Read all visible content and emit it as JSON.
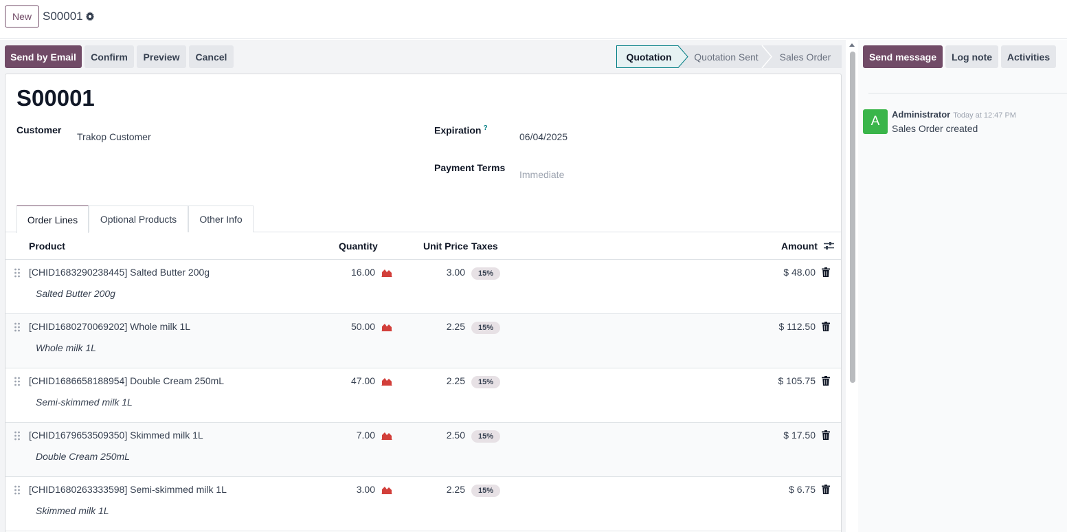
{
  "header": {
    "new_label": "New",
    "breadcrumb": "S00001"
  },
  "actions": {
    "send_email": "Send by Email",
    "confirm": "Confirm",
    "preview": "Preview",
    "cancel": "Cancel"
  },
  "status": {
    "steps": [
      "Quotation",
      "Quotation Sent",
      "Sales Order"
    ],
    "active": "Quotation"
  },
  "form": {
    "title": "S00001",
    "customer_label": "Customer",
    "customer_value": "Trakop Customer",
    "expiration_label": "Expiration",
    "expiration_help": "?",
    "expiration_value": "06/04/2025",
    "payment_terms_label": "Payment Terms",
    "payment_terms_value": "Immediate"
  },
  "tabs": [
    "Order Lines",
    "Optional Products",
    "Other Info"
  ],
  "table": {
    "headers": {
      "product": "Product",
      "quantity": "Quantity",
      "unit_price": "Unit Price",
      "taxes": "Taxes",
      "amount": "Amount"
    },
    "rows": [
      {
        "product": "[CHID1683290238445] Salted Butter 200g",
        "description": "Salted Butter 200g",
        "quantity": "16.00",
        "unit_price": "3.00",
        "tax": "15%",
        "amount": "$ 48.00"
      },
      {
        "product": "[CHID1680270069202] Whole milk 1L",
        "description": "Whole milk 1L",
        "quantity": "50.00",
        "unit_price": "2.25",
        "tax": "15%",
        "amount": "$ 112.50"
      },
      {
        "product": "[CHID1686658188954] Double Cream 250mL",
        "description": "Semi-skimmed milk 1L",
        "quantity": "47.00",
        "unit_price": "2.25",
        "tax": "15%",
        "amount": "$ 105.75"
      },
      {
        "product": "[CHID1679653509350] Skimmed milk 1L",
        "description": "Double Cream 250mL",
        "quantity": "7.00",
        "unit_price": "2.50",
        "tax": "15%",
        "amount": "$ 17.50"
      },
      {
        "product": "[CHID1680263333598] Semi-skimmed milk 1L",
        "description": "Skimmed milk 1L",
        "quantity": "3.00",
        "unit_price": "2.25",
        "tax": "15%",
        "amount": "$ 6.75"
      }
    ]
  },
  "chatter": {
    "send_message": "Send message",
    "log_note": "Log note",
    "activities": "Activities",
    "messages": [
      {
        "avatar": "A",
        "author": "Administrator",
        "time": "Today at 12:47 PM",
        "body": "Sales Order created"
      }
    ]
  },
  "colors": {
    "brand": "#714b67",
    "status_active_border": "#017e84",
    "forecast_icon": "#d23f3a",
    "avatar": "#3ab54a"
  },
  "icons": {
    "gear": "gear-icon",
    "forecast": "area-chart-icon",
    "delete": "trash-icon",
    "handle": "drag-handle-icon",
    "column_settings": "sliders-icon"
  }
}
